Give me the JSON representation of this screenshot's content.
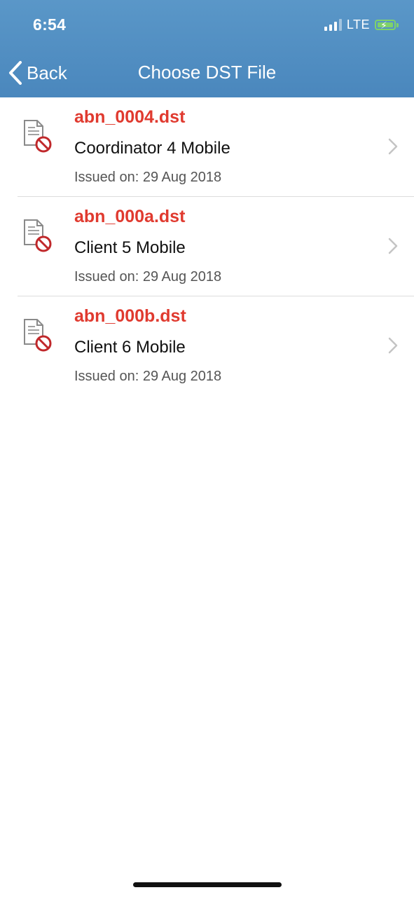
{
  "status_bar": {
    "time": "6:54",
    "network": "LTE",
    "battery_icon": "battery-charging-icon"
  },
  "nav": {
    "back_label": "Back",
    "title": "Choose DST File"
  },
  "colors": {
    "header_bg": "#4f8ec3",
    "filename_red": "#e03a2f",
    "battery_green": "#7fd26a"
  },
  "files": [
    {
      "filename": "abn_0004.dst",
      "client": "Coordinator 4 Mobile",
      "issued": "Issued on: 29 Aug 2018",
      "icon": "document-blocked-icon"
    },
    {
      "filename": "abn_000a.dst",
      "client": "Client 5 Mobile",
      "issued": "Issued on: 29 Aug 2018",
      "icon": "document-blocked-icon"
    },
    {
      "filename": "abn_000b.dst",
      "client": "Client 6 Mobile",
      "issued": "Issued on: 29 Aug 2018",
      "icon": "document-blocked-icon"
    }
  ]
}
